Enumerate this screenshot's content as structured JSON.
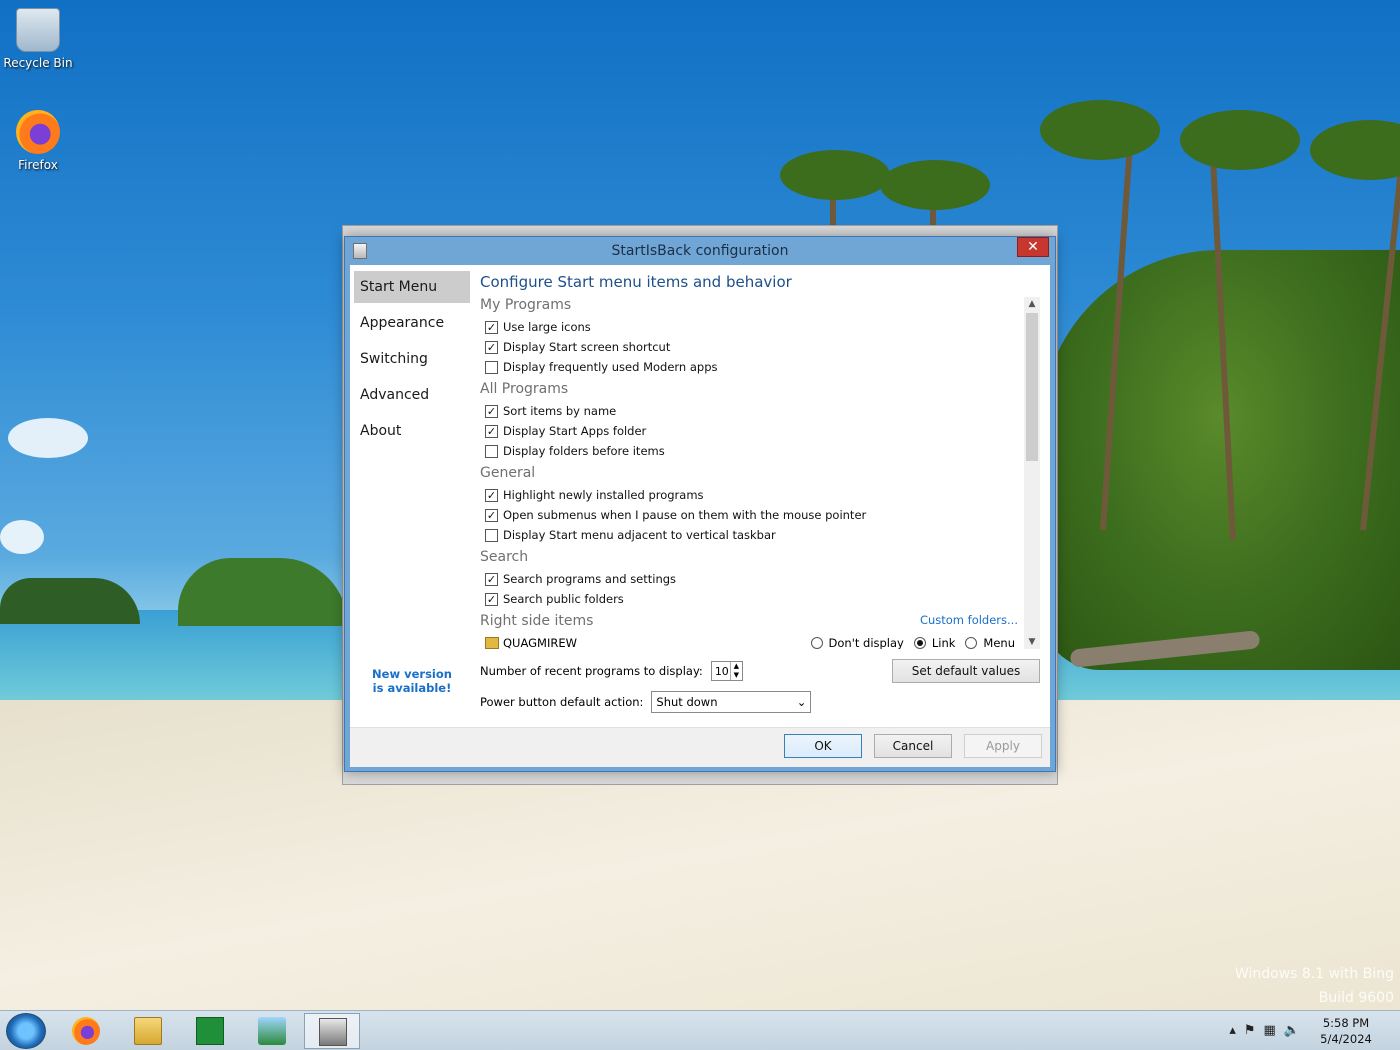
{
  "desktop": {
    "icons": [
      {
        "label": "Recycle Bin"
      },
      {
        "label": "Firefox"
      }
    ],
    "watermark_line1": "Windows 8.1 with Bing",
    "watermark_line2": "Build 9600"
  },
  "window": {
    "title": "StartIsBack configuration",
    "close_label": "✕",
    "nav": [
      {
        "label": "Start Menu",
        "active": true
      },
      {
        "label": "Appearance"
      },
      {
        "label": "Switching"
      },
      {
        "label": "Advanced"
      },
      {
        "label": "About"
      }
    ],
    "new_version": "New version is available!",
    "heading": "Configure Start menu items and behavior",
    "sections": [
      {
        "title": "My Programs",
        "items": [
          {
            "label": "Use large icons",
            "checked": true
          },
          {
            "label": "Display Start screen shortcut",
            "checked": true
          },
          {
            "label": "Display frequently used Modern apps",
            "checked": false
          }
        ]
      },
      {
        "title": "All Programs",
        "items": [
          {
            "label": "Sort items by name",
            "checked": true
          },
          {
            "label": "Display Start Apps folder",
            "checked": true
          },
          {
            "label": "Display folders before items",
            "checked": false
          }
        ]
      },
      {
        "title": "General",
        "items": [
          {
            "label": "Highlight newly installed programs",
            "checked": true
          },
          {
            "label": "Open submenus when I pause on them with the mouse pointer",
            "checked": true
          },
          {
            "label": "Display Start menu adjacent to vertical taskbar",
            "checked": false
          }
        ]
      },
      {
        "title": "Search",
        "items": [
          {
            "label": "Search programs and settings",
            "checked": true
          },
          {
            "label": "Search public folders",
            "checked": true
          }
        ]
      }
    ],
    "right_side": {
      "title": "Right side items",
      "custom_folders": "Custom folders...",
      "item_label": "QUAGMIREW",
      "options": [
        "Don't display",
        "Link",
        "Menu"
      ],
      "selected": "Link"
    },
    "recent_label": "Number of recent programs to display:",
    "recent_value": "10",
    "set_default": "Set default values",
    "power_label": "Power button default action:",
    "power_value": "Shut down",
    "ok": "OK",
    "cancel": "Cancel",
    "apply": "Apply"
  },
  "taskbar": {
    "time": "5:58 PM",
    "date": "5/4/2024"
  }
}
